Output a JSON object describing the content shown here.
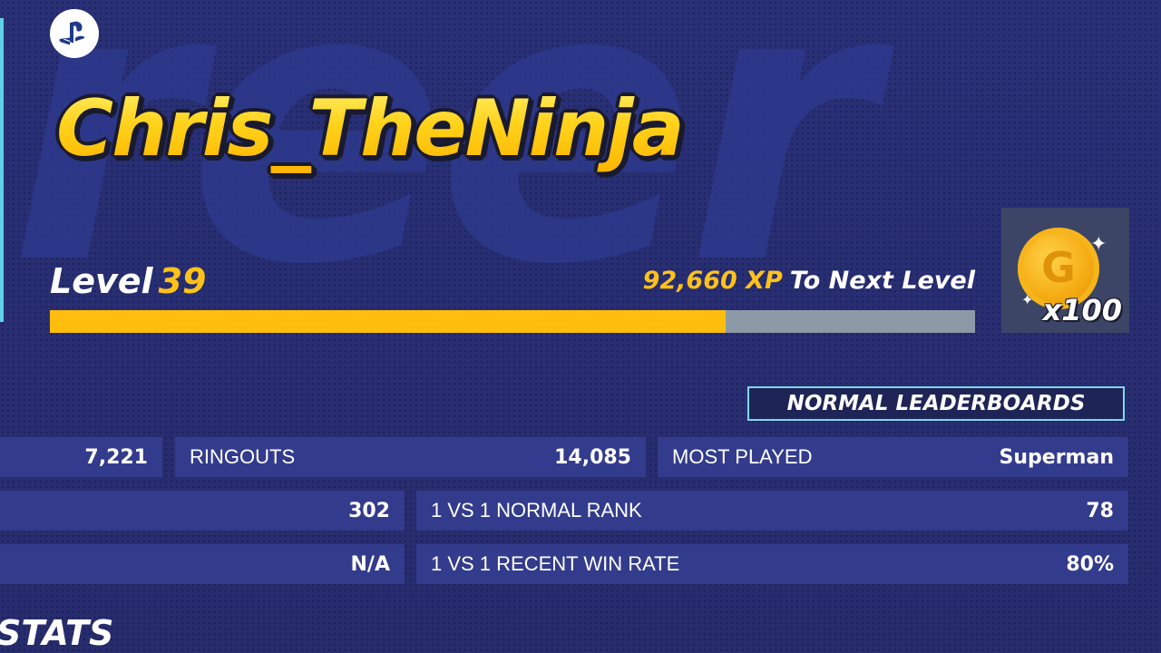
{
  "profile": {
    "player_name": "Chris_TheNinja",
    "level_label": "Level",
    "level_value": "39",
    "xp_amount": "92,660 XP",
    "xp_label": "To Next Level",
    "xp_progress": 0.73,
    "background_word": "reer"
  },
  "reward": {
    "icon": "gold-coin-icon",
    "coin_letter": "G",
    "quantity": "x100"
  },
  "leaderboards_button": "NORMAL LEADERBOARDS",
  "stats": {
    "row1": [
      {
        "value": "7,221"
      },
      {
        "label": "RINGOUTS",
        "value": "14,085"
      },
      {
        "label": "MOST PLAYED",
        "value": "Superman"
      }
    ],
    "row2": [
      {
        "value": "302"
      },
      {
        "label": "1 VS 1 NORMAL RANK",
        "value": "78"
      }
    ],
    "row3": [
      {
        "value": "N/A"
      },
      {
        "label": "1 VS 1 RECENT WIN RATE",
        "value": "80%"
      }
    ]
  },
  "section_title": "STATS",
  "colors": {
    "background": "#282e72",
    "accent_gold": "#ffc21a",
    "xp_track": "#8c9aa8",
    "cell": "#333b8c",
    "button_border": "#7fd8ee"
  }
}
